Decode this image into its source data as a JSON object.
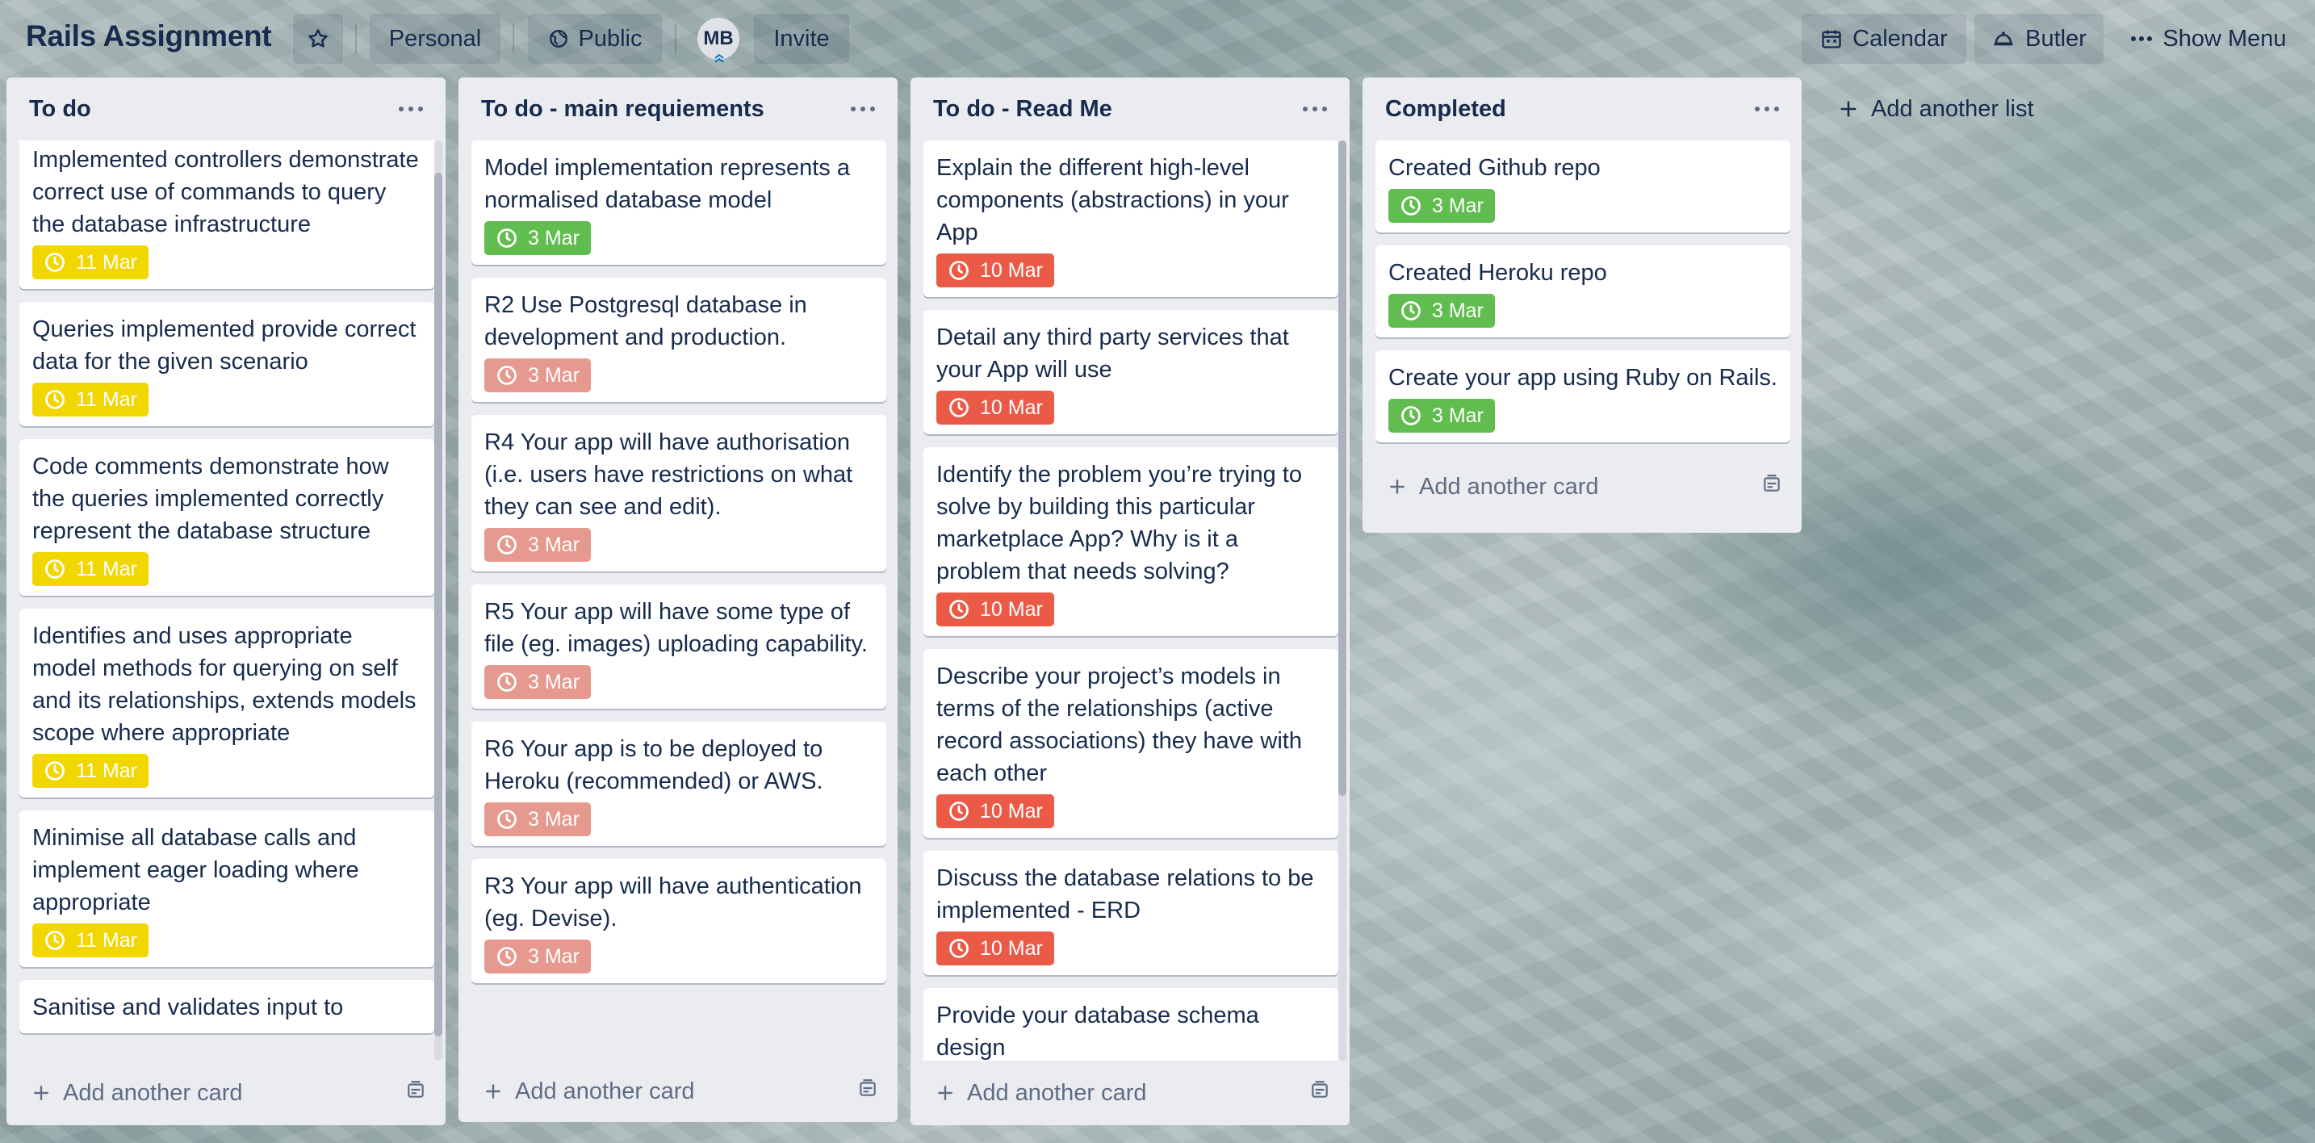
{
  "header": {
    "board_title": "Rails Assignment",
    "star_icon": "star-icon",
    "team_label": "Personal",
    "visibility_label": "Public",
    "avatar_initials": "MB",
    "invite_label": "Invite",
    "calendar_label": "Calendar",
    "butler_label": "Butler",
    "menu_label": "Show Menu"
  },
  "lists": [
    {
      "title": "To do",
      "add_card": "Add another card",
      "cards": [
        {
          "title": "Implemented controllers demonstrate correct use of commands to query the database infrastructure",
          "due": "11 Mar",
          "status": "yellow"
        },
        {
          "title": "Queries implemented provide correct data for the given scenario",
          "due": "11 Mar",
          "status": "yellow"
        },
        {
          "title": "Code comments demonstrate how the queries implemented correctly represent the database structure",
          "due": "11 Mar",
          "status": "yellow"
        },
        {
          "title": "Identifies and uses appropriate model methods for querying on self and its relationships, extends models scope where appropriate",
          "due": "11 Mar",
          "status": "yellow"
        },
        {
          "title": "Minimise all database calls and implement eager loading where appropriate",
          "due": "11 Mar",
          "status": "yellow"
        },
        {
          "title": "Sanitise and validates input to",
          "due": "",
          "status": ""
        }
      ]
    },
    {
      "title": "To do - main requiements",
      "add_card": "Add another card",
      "cards": [
        {
          "title": "Model implementation represents a normalised database model",
          "due": "3 Mar",
          "status": "green"
        },
        {
          "title": "R2 Use Postgresql database in development and production.",
          "due": "3 Mar",
          "status": "faded"
        },
        {
          "title": "R4 Your app will have authorisation (i.e. users have restrictions on what they can see and edit).",
          "due": "3 Mar",
          "status": "faded"
        },
        {
          "title": "R5 Your app will have some type of file (eg. images) uploading capability.",
          "due": "3 Mar",
          "status": "faded"
        },
        {
          "title": "R6 Your app is to be deployed to Heroku (recommended) or AWS.",
          "due": "3 Mar",
          "status": "faded"
        },
        {
          "title": "R3 Your app will have authentication (eg. Devise).",
          "due": "3 Mar",
          "status": "faded"
        }
      ]
    },
    {
      "title": "To do - Read Me",
      "add_card": "Add another card",
      "cards": [
        {
          "title": "Explain the different high-level components (abstractions) in your App",
          "due": "10 Mar",
          "status": "red"
        },
        {
          "title": "Detail any third party services that your App will use",
          "due": "10 Mar",
          "status": "red"
        },
        {
          "title": "Identify the problem you’re trying to solve by building this particular marketplace App? Why is it a problem that needs solving?",
          "due": "10 Mar",
          "status": "red"
        },
        {
          "title": "Describe your project’s models in terms of the relationships (active record associations) they have with each other",
          "due": "10 Mar",
          "status": "red"
        },
        {
          "title": "Discuss the database relations to be implemented - ERD",
          "due": "10 Mar",
          "status": "red"
        },
        {
          "title": "Provide your database schema design",
          "due": "",
          "status": ""
        }
      ]
    },
    {
      "title": "Completed",
      "add_card": "Add another card",
      "cards": [
        {
          "title": "Created Github repo",
          "due": "3 Mar",
          "status": "green"
        },
        {
          "title": "Created Heroku repo",
          "due": "3 Mar",
          "status": "green"
        },
        {
          "title": "Create your app using Ruby on Rails.",
          "due": "3 Mar",
          "status": "green"
        }
      ]
    }
  ],
  "add_list_label": "Add another list",
  "colors": {
    "yellow": "#f2d600",
    "green": "#61bd4f",
    "red": "#eb5a46",
    "faded": "#e6998e",
    "list_bg": "#ebecf0",
    "text": "#172b4d"
  }
}
